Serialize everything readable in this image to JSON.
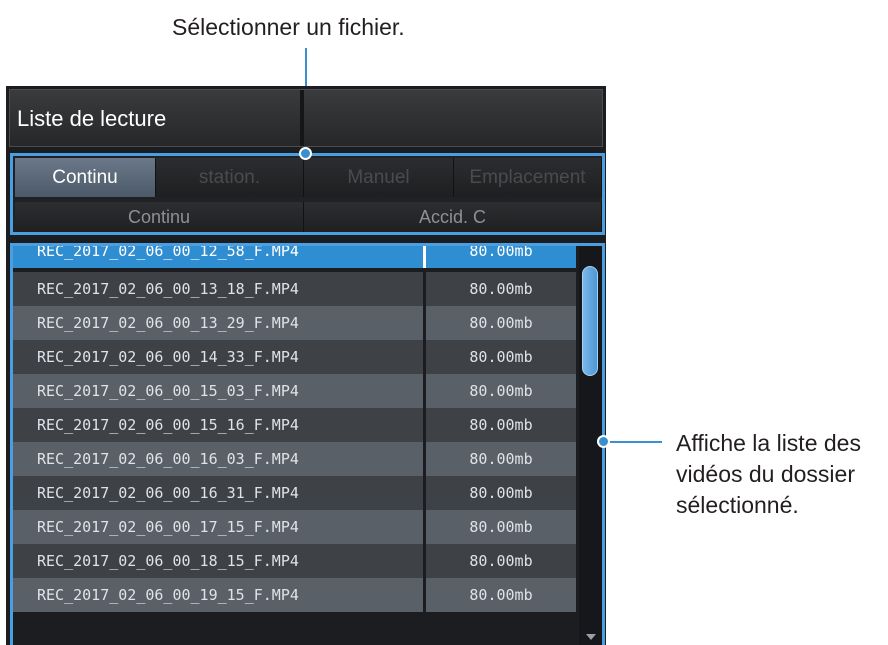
{
  "callouts": {
    "top": "Sélectionner un fichier.",
    "right": "Affiche la liste des vidéos du dossier sélectionné."
  },
  "header": {
    "title": "Liste de lecture"
  },
  "tabs": [
    {
      "label": "Continu",
      "active": true
    },
    {
      "label": "station.",
      "active": false
    },
    {
      "label": "Manuel",
      "active": false
    },
    {
      "label": "Emplacement",
      "active": false
    }
  ],
  "subtabs": [
    {
      "label": "Continu"
    },
    {
      "label": "Accid. C"
    }
  ],
  "files": [
    {
      "name": "REC_2017_02_06_00_12_58_F.MP4",
      "size": "80.00mb",
      "selected": true
    },
    {
      "name": "REC_2017_02_06_00_13_18_F.MP4",
      "size": "80.00mb"
    },
    {
      "name": "REC_2017_02_06_00_13_29_F.MP4",
      "size": "80.00mb"
    },
    {
      "name": "REC_2017_02_06_00_14_33_F.MP4",
      "size": "80.00mb"
    },
    {
      "name": "REC_2017_02_06_00_15_03_F.MP4",
      "size": "80.00mb"
    },
    {
      "name": "REC_2017_02_06_00_15_16_F.MP4",
      "size": "80.00mb"
    },
    {
      "name": "REC_2017_02_06_00_16_03_F.MP4",
      "size": "80.00mb"
    },
    {
      "name": "REC_2017_02_06_00_16_31_F.MP4",
      "size": "80.00mb"
    },
    {
      "name": "REC_2017_02_06_00_17_15_F.MP4",
      "size": "80.00mb"
    },
    {
      "name": "REC_2017_02_06_00_18_15_F.MP4",
      "size": "80.00mb"
    },
    {
      "name": "REC_2017_02_06_00_19_15_F.MP4",
      "size": "80.00mb"
    }
  ],
  "colors": {
    "accent": "#3a8fd0",
    "selected_row": "#2f8dd2",
    "row_dark": "#3e4145",
    "row_light": "#5a6068"
  }
}
